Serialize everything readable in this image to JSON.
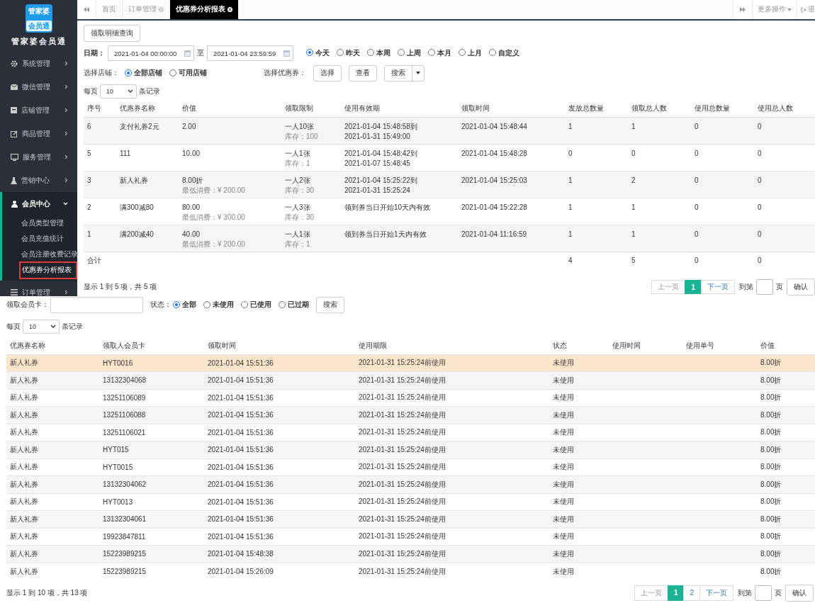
{
  "sidebar": {
    "logo_top": "管家婆",
    "logo_bottom": "会员通",
    "brand": "管家婆会员通",
    "items": [
      {
        "label": "系统管理",
        "expanded": false
      },
      {
        "label": "微信管理",
        "expanded": false
      },
      {
        "label": "店铺管理",
        "expanded": false
      },
      {
        "label": "商品管理",
        "expanded": false
      },
      {
        "label": "服务管理",
        "expanded": false
      },
      {
        "label": "营销中心",
        "expanded": false
      },
      {
        "label": "会员中心",
        "expanded": true,
        "children": [
          {
            "label": "会员类型管理",
            "selected": false
          },
          {
            "label": "会员充值统计",
            "selected": false
          },
          {
            "label": "会员注册收费记录",
            "selected": false
          },
          {
            "label": "优惠券分析报表",
            "selected": true
          }
        ]
      },
      {
        "label": "订单管理",
        "expanded": false
      }
    ]
  },
  "tabs": [
    {
      "label": "首页",
      "closable": false,
      "selected": false
    },
    {
      "label": "订单管理",
      "closable": true,
      "selected": false
    },
    {
      "label": "优惠券分析报表",
      "closable": true,
      "selected": true
    }
  ],
  "tab_actions": {
    "more": "更多操作",
    "logout": "退"
  },
  "report": {
    "detail_button": "领取明细查询",
    "date_label": "日期：",
    "date_from": "2021-01-04 00:00:00",
    "date_sep": "至",
    "date_to": "2021-01-04 23:59:59",
    "ranges": [
      {
        "label": "今天",
        "selected": true
      },
      {
        "label": "昨天",
        "selected": false
      },
      {
        "label": "本周",
        "selected": false
      },
      {
        "label": "上周",
        "selected": false
      },
      {
        "label": "本月",
        "selected": false
      },
      {
        "label": "上月",
        "selected": false
      },
      {
        "label": "自定义",
        "selected": false
      }
    ],
    "store_label": "选择店铺：",
    "stores": [
      {
        "label": "全部店铺",
        "selected": true
      },
      {
        "label": "可用店铺",
        "selected": false
      }
    ],
    "coupon_label": "选择优惠券：",
    "select_button": "选择",
    "view_button": "查看",
    "search_button": "搜索",
    "page_size": {
      "before": "每页",
      "value": "10",
      "after": "条记录"
    },
    "columns": [
      "序号",
      "优惠券名称",
      "价值",
      "领取限制",
      "使用有效期",
      "领取时间",
      "发放总数量",
      "领取总人数",
      "使用总数量",
      "使用总人数"
    ],
    "rows": [
      {
        "cells": [
          {
            "lines": [
              "6"
            ]
          },
          {
            "lines": [
              "支付礼券2元"
            ]
          },
          {
            "lines": [
              "2.00"
            ]
          },
          {
            "lines": [
              "一人10张"
            ],
            "note": "库存：100"
          },
          {
            "lines": [
              "2021-01-04 15:48:58到",
              "2021-01-31 15:49:00"
            ]
          },
          {
            "lines": [
              "2021-01-04 15:48:44"
            ]
          },
          {
            "lines": [
              "1"
            ]
          },
          {
            "lines": [
              "1"
            ]
          },
          {
            "lines": [
              "0"
            ]
          },
          {
            "lines": [
              "0"
            ]
          }
        ]
      },
      {
        "cells": [
          {
            "lines": [
              "5"
            ]
          },
          {
            "lines": [
              "111"
            ]
          },
          {
            "lines": [
              "10.00"
            ]
          },
          {
            "lines": [
              "一人1张"
            ],
            "note": "库存：1"
          },
          {
            "lines": [
              "2021-01-04 15:48:42到",
              "2021-01-07 15:48:45"
            ]
          },
          {
            "lines": [
              "2021-01-04 15:48:28"
            ]
          },
          {
            "lines": [
              "0"
            ]
          },
          {
            "lines": [
              "0"
            ]
          },
          {
            "lines": [
              "0"
            ]
          },
          {
            "lines": [
              "0"
            ]
          }
        ]
      },
      {
        "cells": [
          {
            "lines": [
              "3"
            ]
          },
          {
            "lines": [
              "新人礼券"
            ]
          },
          {
            "lines": [
              "8.00折"
            ],
            "note": "最低消费：¥ 200.00"
          },
          {
            "lines": [
              "一人2张"
            ],
            "note": "库存：30"
          },
          {
            "lines": [
              "2021-01-04 15:25:22到",
              "2021-01-31 15:25:24"
            ]
          },
          {
            "lines": [
              "2021-01-04 15:25:03"
            ]
          },
          {
            "lines": [
              "1"
            ]
          },
          {
            "lines": [
              "2"
            ]
          },
          {
            "lines": [
              "0"
            ]
          },
          {
            "lines": [
              "0"
            ]
          }
        ]
      },
      {
        "cells": [
          {
            "lines": [
              "2"
            ]
          },
          {
            "lines": [
              "满300减80"
            ]
          },
          {
            "lines": [
              "80.00"
            ],
            "note": "最低消费：¥ 300.00"
          },
          {
            "lines": [
              "一人3张"
            ],
            "note": "库存：30"
          },
          {
            "lines": [
              "领到券当日开始10天内有效"
            ]
          },
          {
            "lines": [
              "2021-01-04 15:22:28"
            ]
          },
          {
            "lines": [
              "1"
            ]
          },
          {
            "lines": [
              "1"
            ]
          },
          {
            "lines": [
              "0"
            ]
          },
          {
            "lines": [
              "0"
            ]
          }
        ]
      },
      {
        "cells": [
          {
            "lines": [
              "1"
            ]
          },
          {
            "lines": [
              "满200减40"
            ]
          },
          {
            "lines": [
              "40.00"
            ],
            "note": "最低消费：¥ 200.00"
          },
          {
            "lines": [
              "一人1张"
            ],
            "note": "库存：1"
          },
          {
            "lines": [
              "领到券当日开始1天内有效"
            ]
          },
          {
            "lines": [
              "2021-01-04 11:16:59"
            ]
          },
          {
            "lines": [
              "1"
            ]
          },
          {
            "lines": [
              "1"
            ]
          },
          {
            "lines": [
              "0"
            ]
          },
          {
            "lines": [
              "0"
            ]
          }
        ]
      }
    ],
    "total": {
      "label": "合计",
      "counts": [
        "4",
        "5",
        "0",
        "0"
      ]
    },
    "info": "显示 1 到 5 项，共 5 项",
    "pager": {
      "prev": "上一页",
      "pages": [
        {
          "label": "1",
          "selected": true
        }
      ],
      "next": "下一页",
      "goto": "到第",
      "unit": "页",
      "confirm": "确认"
    }
  },
  "detail": {
    "card_label": "领取会员卡：",
    "status_label": "状态：",
    "statuses": [
      {
        "label": "全部",
        "selected": true
      },
      {
        "label": "未使用",
        "selected": false
      },
      {
        "label": "已使用",
        "selected": false
      },
      {
        "label": "已过期",
        "selected": false
      }
    ],
    "search_button": "搜索",
    "page_size": {
      "before": "每页",
      "value": "10",
      "after": "条记录"
    },
    "columns": [
      "优惠券名称",
      "领取人会员卡",
      "领取时间",
      "使用期限",
      "状态",
      "使用时间",
      "使用单号",
      "价值"
    ],
    "rows": [
      {
        "coupon": "新人礼券",
        "card": "HYT0016",
        "time": "2021-01-04 15:51:36",
        "period": "2021-01-31 15:25:24前使用",
        "status": "未使用",
        "value": "8.00折",
        "highlighted": true
      },
      {
        "coupon": "新人礼券",
        "card": "13132304068",
        "time": "2021-01-04 15:51:36",
        "period": "2021-01-31 15:25:24前使用",
        "status": "未使用",
        "value": "8.00折",
        "highlighted": false
      },
      {
        "coupon": "新人礼券",
        "card": "13251106089",
        "time": "2021-01-04 15:51:36",
        "period": "2021-01-31 15:25:24前使用",
        "status": "未使用",
        "value": "8.00折",
        "highlighted": false
      },
      {
        "coupon": "新人礼券",
        "card": "13251106088",
        "time": "2021-01-04 15:51:36",
        "period": "2021-01-31 15:25:24前使用",
        "status": "未使用",
        "value": "8.00折",
        "highlighted": false
      },
      {
        "coupon": "新人礼券",
        "card": "13251106021",
        "time": "2021-01-04 15:51:36",
        "period": "2021-01-31 15:25:24前使用",
        "status": "未使用",
        "value": "8.00折",
        "highlighted": false
      },
      {
        "coupon": "新人礼券",
        "card": "HYT015",
        "time": "2021-01-04 15:51:36",
        "period": "2021-01-31 15:25:24前使用",
        "status": "未使用",
        "value": "8.00折",
        "highlighted": false
      },
      {
        "coupon": "新人礼券",
        "card": "HYT0015",
        "time": "2021-01-04 15:51:36",
        "period": "2021-01-31 15:25:24前使用",
        "status": "未使用",
        "value": "8.00折",
        "highlighted": false
      },
      {
        "coupon": "新人礼券",
        "card": "13132304062",
        "time": "2021-01-04 15:51:36",
        "period": "2021-01-31 15:25:24前使用",
        "status": "未使用",
        "value": "8.00折",
        "highlighted": false
      },
      {
        "coupon": "新人礼券",
        "card": "HYT0013",
        "time": "2021-01-04 15:51:36",
        "period": "2021-01-31 15:25:24前使用",
        "status": "未使用",
        "value": "8.00折",
        "highlighted": false
      },
      {
        "coupon": "新人礼券",
        "card": "13132304061",
        "time": "2021-01-04 15:51:36",
        "period": "2021-01-31 15:25:24前使用",
        "status": "未使用",
        "value": "8.00折",
        "highlighted": false
      },
      {
        "coupon": "新人礼券",
        "card": "19923847811",
        "time": "2021-01-04 15:51:36",
        "period": "2021-01-31 15:25:24前使用",
        "status": "未使用",
        "value": "8.00折",
        "highlighted": false
      },
      {
        "coupon": "新人礼券",
        "card": "15223989215",
        "time": "2021-01-04 15:48:38",
        "period": "2021-01-31 15:25:24前使用",
        "status": "未使用",
        "value": "8.00折",
        "highlighted": false
      },
      {
        "coupon": "新人礼券",
        "card": "15223989215",
        "time": "2021-01-04 15:26:09",
        "period": "2021-01-31 15:25:24前使用",
        "status": "未使用",
        "value": "8.00折",
        "highlighted": false
      }
    ],
    "info": "显示 1 到 10 项，共 13 项",
    "pager": {
      "prev": "上一页",
      "pages": [
        {
          "label": "1",
          "selected": true
        },
        {
          "label": "2",
          "selected": false
        }
      ],
      "next": "下一页",
      "goto": "到第",
      "unit": "页",
      "confirm": "确认"
    }
  }
}
